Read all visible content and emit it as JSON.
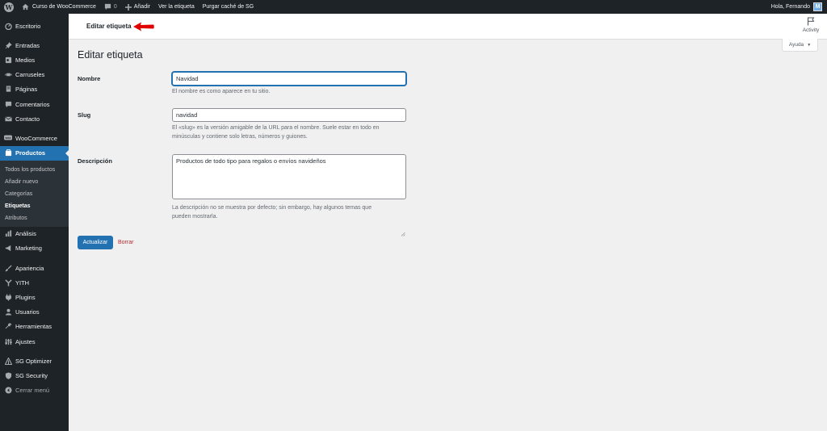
{
  "adminbar": {
    "wp_logo": "W",
    "site_name": "Curso de WooCommerce",
    "comments_count": "0",
    "add_new": "Añadir",
    "view_tag": "Ver la etiqueta",
    "purge_cache": "Purgar caché de SG",
    "greeting": "Hola, Fernando",
    "avatar_letter": "M"
  },
  "sidebar": {
    "items": [
      {
        "label": "Escritorio",
        "icon": "dashboard-icon"
      },
      {
        "label": "Entradas",
        "icon": "pin-icon"
      },
      {
        "label": "Medios",
        "icon": "media-icon"
      },
      {
        "label": "Carruseles",
        "icon": "carousel-icon"
      },
      {
        "label": "Páginas",
        "icon": "pages-icon"
      },
      {
        "label": "Comentarios",
        "icon": "comments-icon"
      },
      {
        "label": "Contacto",
        "icon": "mail-icon"
      },
      {
        "label": "WooCommerce",
        "icon": "woo-icon"
      },
      {
        "label": "Productos",
        "icon": "products-icon"
      },
      {
        "label": "Análisis",
        "icon": "analytics-icon"
      },
      {
        "label": "Marketing",
        "icon": "megaphone-icon"
      },
      {
        "label": "Apariencia",
        "icon": "brush-icon"
      },
      {
        "label": "YITH",
        "icon": "yith-icon"
      },
      {
        "label": "Plugins",
        "icon": "plugin-icon"
      },
      {
        "label": "Usuarios",
        "icon": "users-icon"
      },
      {
        "label": "Herramientas",
        "icon": "wrench-icon"
      },
      {
        "label": "Ajustes",
        "icon": "settings-icon"
      },
      {
        "label": "SG Optimizer",
        "icon": "sg-optimizer-icon"
      },
      {
        "label": "SG Security",
        "icon": "shield-icon"
      },
      {
        "label": "Cerrar menú",
        "icon": "collapse-icon"
      }
    ],
    "submenu": [
      {
        "label": "Todos los productos"
      },
      {
        "label": "Añadir nuevo"
      },
      {
        "label": "Categorías"
      },
      {
        "label": "Etiquetas"
      },
      {
        "label": "Atributos"
      }
    ]
  },
  "header": {
    "title": "Editar etiqueta",
    "activity_label": "Activity"
  },
  "help": {
    "label": "Ayuda"
  },
  "main": {
    "page_title": "Editar etiqueta",
    "name": {
      "label": "Nombre",
      "value": "Navidad",
      "description": "El nombre es como aparece en tu sitio."
    },
    "slug": {
      "label": "Slug",
      "value": "navidad",
      "description_line1": "El «slug» es la versión amigable de la URL para el nombre. Suele estar en todo en",
      "description_line2": "minúsculas y contiene solo letras, números y guiones."
    },
    "description": {
      "label": "Descripción",
      "value": "Productos de todo tipo para regalos o envíos navideños",
      "description_line1": "La descripción no se muestra por defecto; sin embargo, hay algunos temas que",
      "description_line2": "pueden mostrarla."
    },
    "update_button": "Actualizar",
    "delete_link": "Borrar"
  },
  "colors": {
    "admin_dark": "#1d2327",
    "accent": "#2271b1",
    "delete": "#b32d2e",
    "annotation_arrow": "#e00000"
  }
}
